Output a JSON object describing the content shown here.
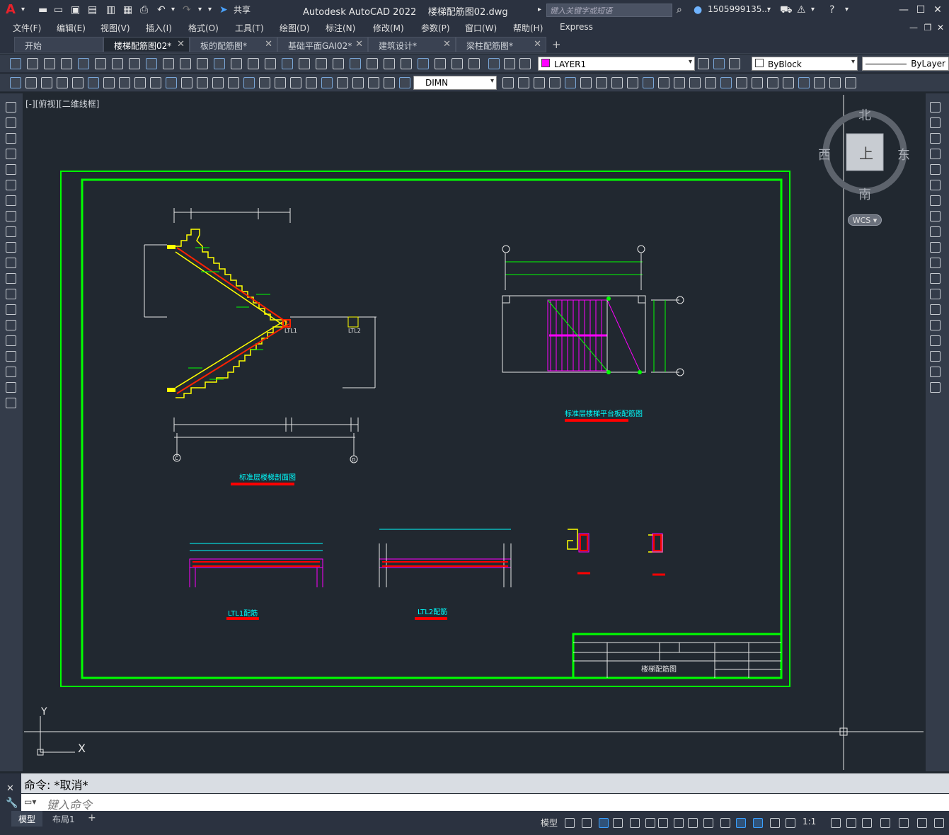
{
  "app": {
    "title": "Autodesk AutoCAD 2022",
    "filename": "楼梯配筋图02.dwg",
    "search_placeholder": "键入关键字或短语",
    "user": "1505999135...",
    "share_label": "共享"
  },
  "menus": [
    "文件(F)",
    "编辑(E)",
    "视图(V)",
    "插入(I)",
    "格式(O)",
    "工具(T)",
    "绘图(D)",
    "标注(N)",
    "修改(M)",
    "参数(P)",
    "窗口(W)",
    "帮助(H)",
    "Express"
  ],
  "tabs": [
    {
      "label": "开始",
      "active": false,
      "closable": false
    },
    {
      "label": "楼梯配筋图02*",
      "active": true,
      "closable": true
    },
    {
      "label": "板的配筋图*",
      "active": false,
      "closable": true
    },
    {
      "label": "基础平面GAI02*",
      "active": false,
      "closable": true
    },
    {
      "label": "建筑设计*",
      "active": false,
      "closable": true
    },
    {
      "label": "梁柱配筋图*",
      "active": false,
      "closable": true
    }
  ],
  "add_tab": "+",
  "toolbar": {
    "layer": "LAYER1",
    "color": "ByBlock",
    "linetype": "ByLayer",
    "dimstyle": "DIMN",
    "layer_color": "#ff00ff"
  },
  "view_label": "[-][俯视][二维线框]",
  "viewcube": {
    "north": "北",
    "south": "南",
    "east": "东",
    "west": "西",
    "face": "上",
    "wcs": "WCS"
  },
  "ucs": {
    "x": "X",
    "y": "Y"
  },
  "drawing": {
    "title_stair_section": "标准层楼梯剖面图",
    "title_stair_plan": "标准层楼梯平台板配筋图",
    "title_ltl1_detail": "LTL1配筋",
    "title_ltl2_detail": "LTL2配筋",
    "label_ltl1": "LTL1",
    "label_ltl2": "LTL2",
    "axis_c": "C",
    "axis_d": "D",
    "title_block_name": "楼梯配筋图"
  },
  "command": {
    "history": "命令: *取消*",
    "placeholder": "键入命令"
  },
  "layout_tabs": [
    {
      "label": "模型",
      "active": true
    },
    {
      "label": "布局1",
      "active": false
    }
  ],
  "status": {
    "model": "模型",
    "scale": "1:1"
  }
}
